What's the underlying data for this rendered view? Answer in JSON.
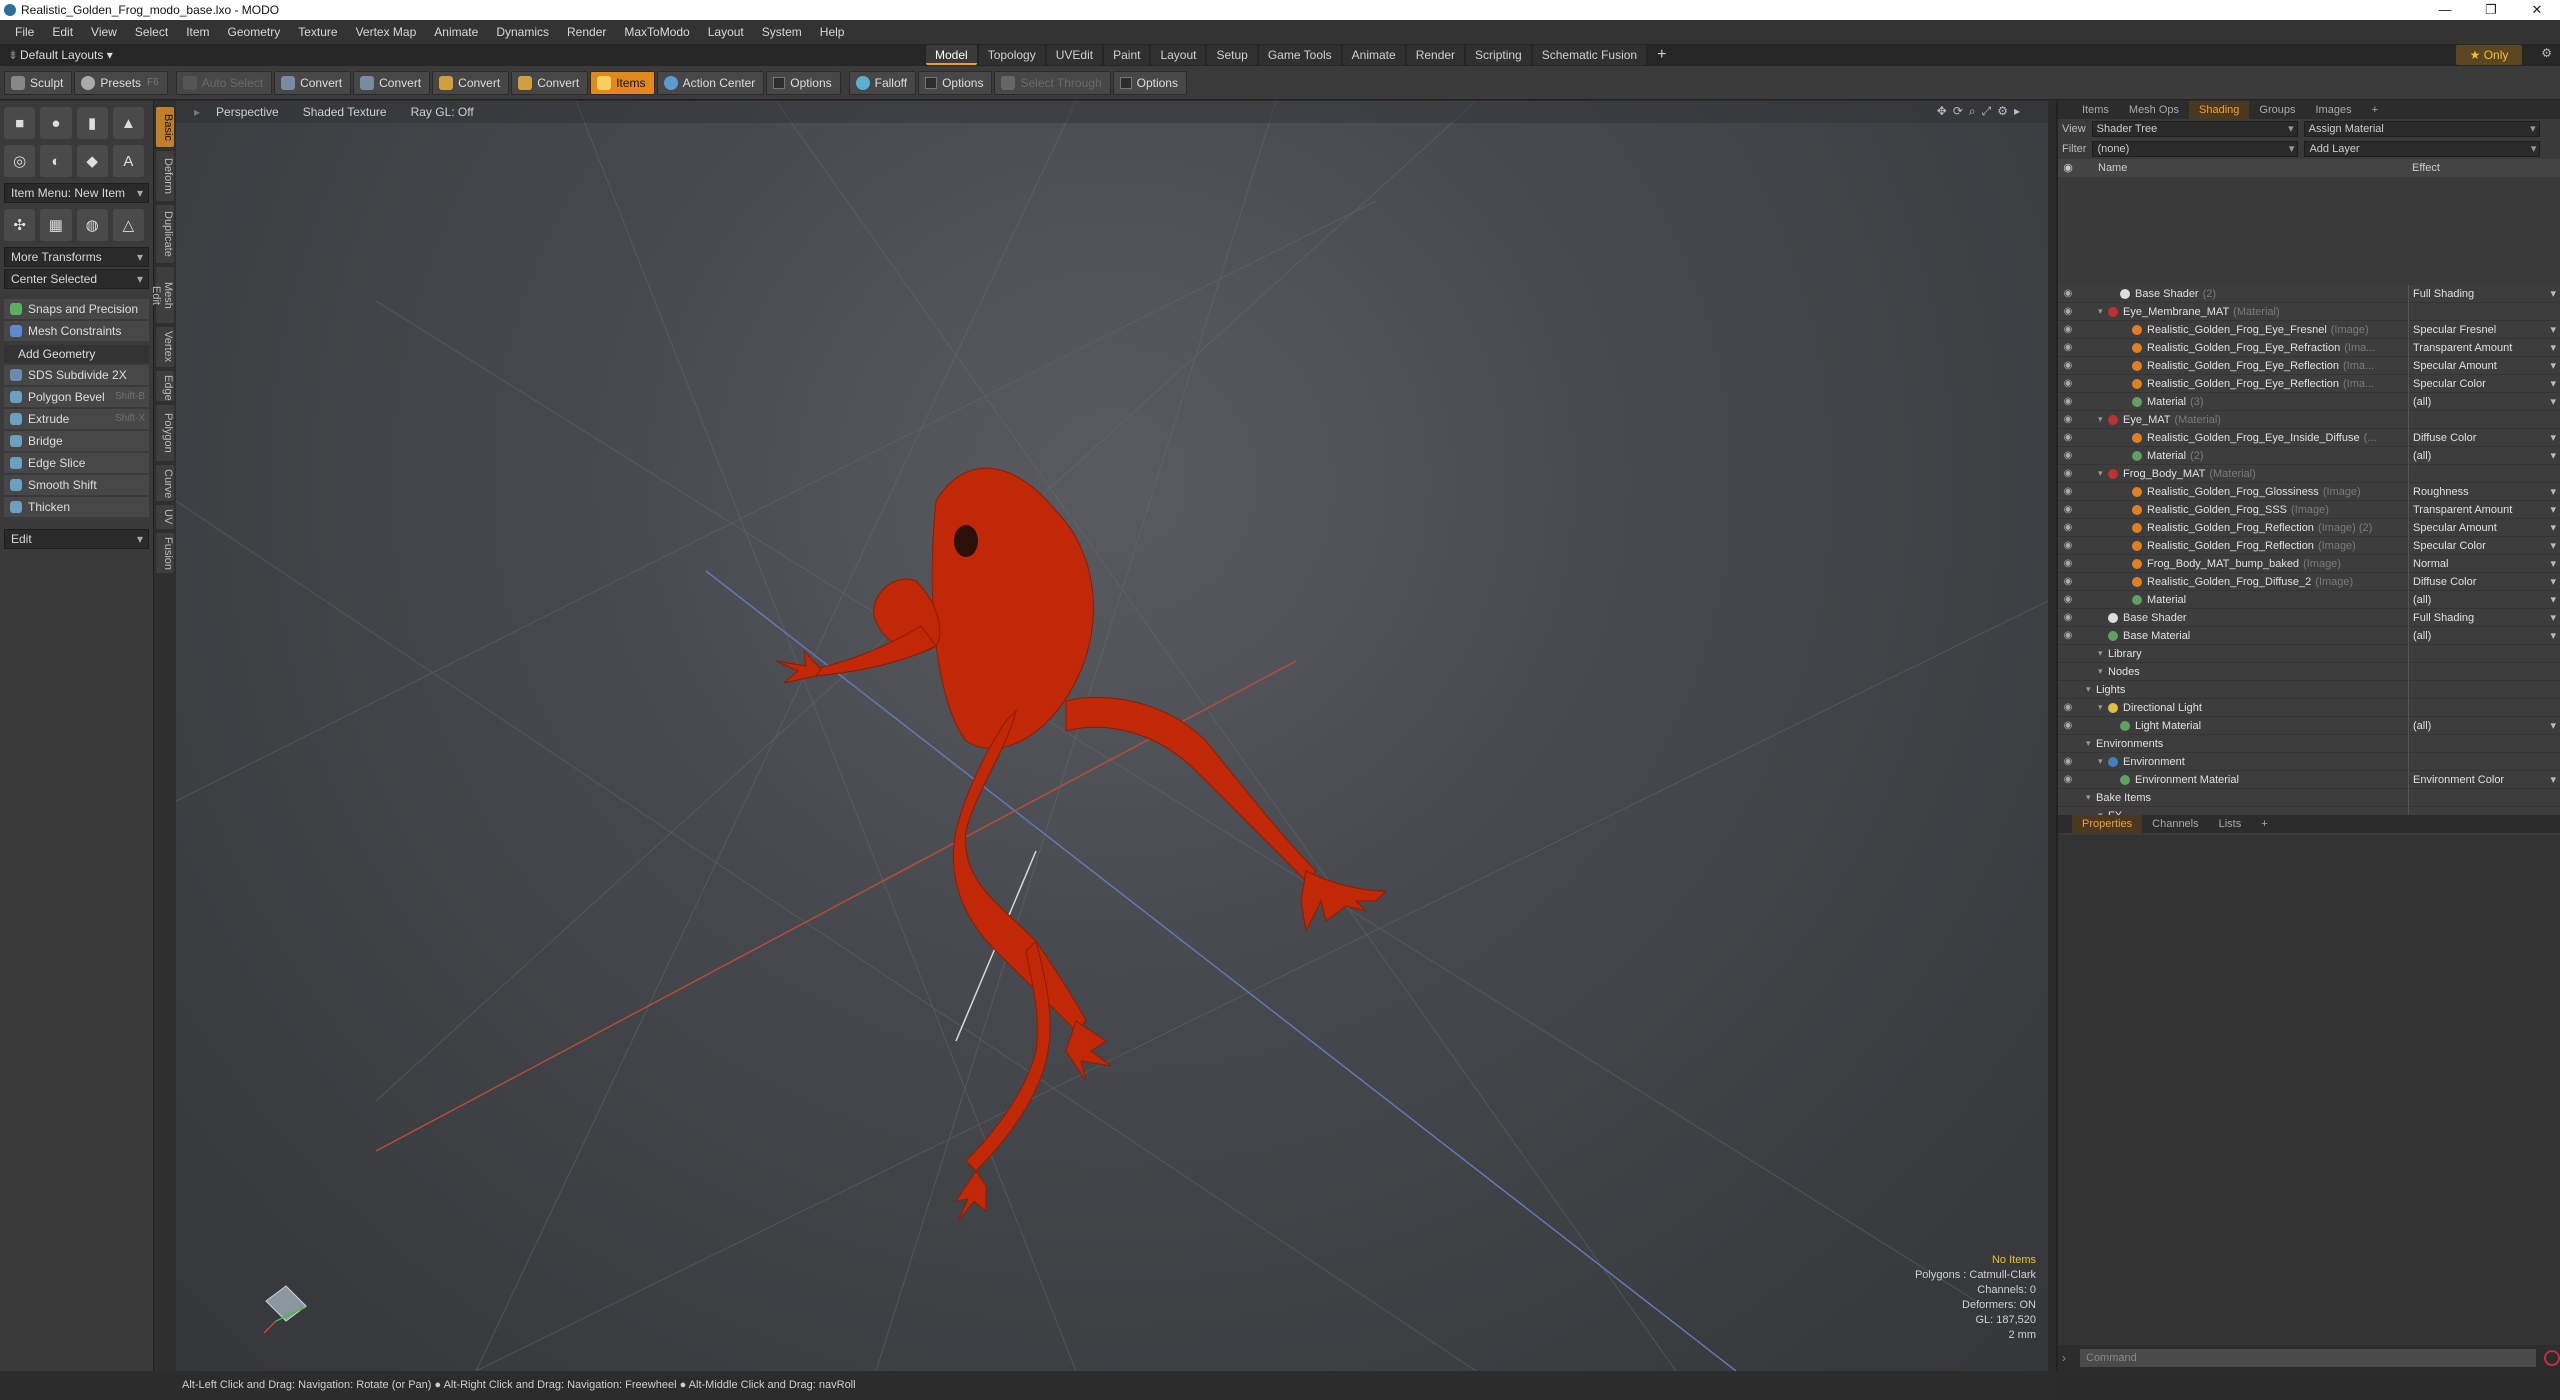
{
  "window": {
    "title": "Realistic_Golden_Frog_modo_base.lxo - MODO",
    "min": "—",
    "restore": "❐",
    "close": "✕"
  },
  "menu": [
    "File",
    "Edit",
    "View",
    "Select",
    "Item",
    "Geometry",
    "Texture",
    "Vertex Map",
    "Animate",
    "Dynamics",
    "Render",
    "MaxToModo",
    "Layout",
    "System",
    "Help"
  ],
  "layout": {
    "label": "Default Layouts ▾",
    "tabs": [
      "Model",
      "Topology",
      "UVEdit",
      "Paint",
      "Layout",
      "Setup",
      "Game Tools",
      "Animate",
      "Render",
      "Scripting",
      "Schematic Fusion"
    ],
    "active_tab": "Model",
    "plus": "+",
    "only": "★ Only"
  },
  "toolbar": {
    "sculpt": "Sculpt",
    "presets": "Presets",
    "presets_key": "F6",
    "auto_select": "Auto Select",
    "convert": "Convert",
    "items": "Items",
    "action_center": "Action Center",
    "options": "Options",
    "falloff": "Falloff",
    "select_through": "Select Through"
  },
  "left": {
    "item_menu": "Item Menu: New Item",
    "more_transforms": "More Transforms",
    "center_selected": "Center Selected",
    "snaps": "Snaps and Precision",
    "mesh_constraints": "Mesh Constraints",
    "add_geometry": "Add Geometry",
    "tools": [
      {
        "label": "SDS Subdivide 2X",
        "key": ""
      },
      {
        "label": "Polygon Bevel",
        "key": "Shift-B"
      },
      {
        "label": "Extrude",
        "key": "Shift-X"
      },
      {
        "label": "Bridge",
        "key": ""
      },
      {
        "label": "Edge Slice",
        "key": ""
      },
      {
        "label": "Smooth Shift",
        "key": ""
      },
      {
        "label": "Thicken",
        "key": ""
      }
    ],
    "edit": "Edit",
    "vtabs": [
      "Basic",
      "Deform",
      "Duplicate",
      "Mesh Edit",
      "Vertex",
      "Edge",
      "Polygon",
      "Curve",
      "UV",
      "Fusion"
    ]
  },
  "viewport": {
    "view": "Perspective",
    "shading": "Shaded Texture",
    "raygl": "Ray GL: Off",
    "info": {
      "items": "No Items",
      "polygons": "Polygons : Catmull-Clark",
      "channels": "Channels: 0",
      "deformers": "Deformers: ON",
      "gl": "GL: 187,520",
      "scale": "2 mm"
    }
  },
  "right": {
    "tabs": [
      "Items",
      "Mesh Ops",
      "Shading",
      "Groups",
      "Images"
    ],
    "active_tab": "Shading",
    "view_label": "View",
    "view_value": "Shader Tree",
    "assign": "Assign Material",
    "filter_label": "Filter",
    "filter_value": "(none)",
    "add_layer": "Add Layer",
    "col_name": "Name",
    "col_effect": "Effect",
    "tree": [
      {
        "name": "Base Shader",
        "tag": "(2)",
        "effect": "Full Shading",
        "indent": 2,
        "ball": "#dddddd"
      },
      {
        "name": "Eye_Membrane_MAT",
        "tag": "(Material)",
        "effect": "",
        "indent": 1,
        "ball": "#c03030"
      },
      {
        "name": "Realistic_Golden_Frog_Eye_Fresnel",
        "tag": "(Image)",
        "effect": "Specular Fresnel",
        "indent": 3,
        "ball": "#e08020"
      },
      {
        "name": "Realistic_Golden_Frog_Eye_Refraction",
        "tag": "(Ima...",
        "effect": "Transparent Amount",
        "indent": 3,
        "ball": "#e08020"
      },
      {
        "name": "Realistic_Golden_Frog_Eye_Reflection",
        "tag": "(Ima...",
        "effect": "Specular Amount",
        "indent": 3,
        "ball": "#e08020"
      },
      {
        "name": "Realistic_Golden_Frog_Eye_Reflection",
        "tag": "(Ima...",
        "effect": "Specular Color",
        "indent": 3,
        "ball": "#e08020"
      },
      {
        "name": "Material",
        "tag": "(3)",
        "effect": "(all)",
        "indent": 3,
        "ball": "#60a060"
      },
      {
        "name": "Eye_MAT",
        "tag": "(Material)",
        "effect": "",
        "indent": 1,
        "ball": "#c03030"
      },
      {
        "name": "Realistic_Golden_Frog_Eye_Inside_Diffuse",
        "tag": "(...",
        "effect": "Diffuse Color",
        "indent": 3,
        "ball": "#e08020"
      },
      {
        "name": "Material",
        "tag": "(2)",
        "effect": "(all)",
        "indent": 3,
        "ball": "#60a060"
      },
      {
        "name": "Frog_Body_MAT",
        "tag": "(Material)",
        "effect": "",
        "indent": 1,
        "ball": "#c03030"
      },
      {
        "name": "Realistic_Golden_Frog_Glossiness",
        "tag": "(Image)",
        "effect": "Roughness",
        "indent": 3,
        "ball": "#e08020"
      },
      {
        "name": "Realistic_Golden_Frog_SSS",
        "tag": "(Image)",
        "effect": "Transparent Amount",
        "indent": 3,
        "ball": "#e08020"
      },
      {
        "name": "Realistic_Golden_Frog_Reflection",
        "tag": "(Image) (2)",
        "effect": "Specular Amount",
        "indent": 3,
        "ball": "#e08020"
      },
      {
        "name": "Realistic_Golden_Frog_Reflection",
        "tag": "(Image)",
        "effect": "Specular Color",
        "indent": 3,
        "ball": "#e08020"
      },
      {
        "name": "Frog_Body_MAT_bump_baked",
        "tag": "(Image)",
        "effect": "Normal",
        "indent": 3,
        "ball": "#e08020"
      },
      {
        "name": "Realistic_Golden_Frog_Diffuse_2",
        "tag": "(Image)",
        "effect": "Diffuse Color",
        "indent": 3,
        "ball": "#e08020"
      },
      {
        "name": "Material",
        "tag": "",
        "effect": "(all)",
        "indent": 3,
        "ball": "#60a060"
      },
      {
        "name": "Base Shader",
        "tag": "",
        "effect": "Full Shading",
        "indent": 1,
        "ball": "#dddddd"
      },
      {
        "name": "Base Material",
        "tag": "",
        "effect": "(all)",
        "indent": 1,
        "ball": "#60a060"
      },
      {
        "name": "Library",
        "tag": "",
        "effect": "",
        "indent": 1,
        "ball": ""
      },
      {
        "name": "Nodes",
        "tag": "",
        "effect": "",
        "indent": 1,
        "ball": ""
      },
      {
        "name": "Lights",
        "tag": "",
        "effect": "",
        "indent": 0,
        "ball": ""
      },
      {
        "name": "Directional Light",
        "tag": "",
        "effect": "",
        "indent": 1,
        "ball": "#e0c040"
      },
      {
        "name": "Light Material",
        "tag": "",
        "effect": "(all)",
        "indent": 2,
        "ball": "#60a060"
      },
      {
        "name": "Environments",
        "tag": "",
        "effect": "",
        "indent": 0,
        "ball": ""
      },
      {
        "name": "Environment",
        "tag": "",
        "effect": "",
        "indent": 1,
        "ball": "#4080c0"
      },
      {
        "name": "Environment Material",
        "tag": "",
        "effect": "Environment Color",
        "indent": 2,
        "ball": "#60a060"
      },
      {
        "name": "Bake Items",
        "tag": "",
        "effect": "",
        "indent": 0,
        "ball": ""
      },
      {
        "name": "FX",
        "tag": "",
        "effect": "",
        "indent": 1,
        "ball": ""
      }
    ],
    "bottom_tabs": [
      "Properties",
      "Channels",
      "Lists"
    ],
    "bottom_active": "Properties",
    "command_placeholder": "Command"
  },
  "status": "Alt-Left Click and Drag: Navigation: Rotate (or Pan) ● Alt-Right Click and Drag: Navigation: Freewheel ● Alt-Middle Click and Drag: navRoll",
  "colors": {
    "accent": "#f0a030",
    "frog": "#c02808",
    "items_button": "#e08a1e"
  }
}
